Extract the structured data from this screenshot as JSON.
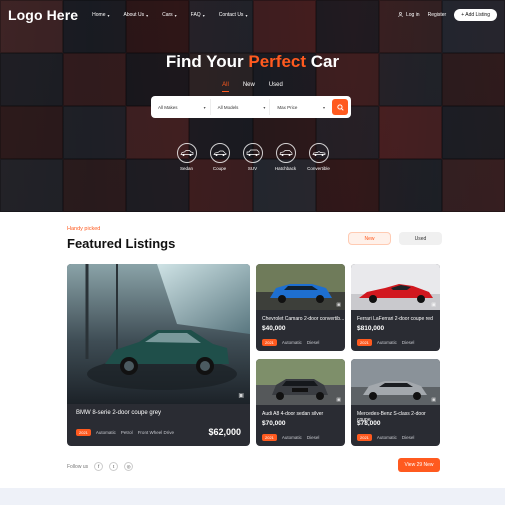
{
  "nav": {
    "logo": "Logo Here",
    "menu": [
      {
        "label": "Home"
      },
      {
        "label": "About Us"
      },
      {
        "label": "Cars"
      },
      {
        "label": "FAQ"
      },
      {
        "label": "Contact Us"
      }
    ],
    "login": "Log in",
    "register": "Register",
    "add_listing": "+ Add Listing"
  },
  "hero": {
    "title_before": "Find Your ",
    "title_accent": "Perfect",
    "title_after": " Car",
    "tabs": [
      "All",
      "New",
      "Used"
    ],
    "active_tab": "All",
    "search": {
      "makes": "All Makes",
      "models": "All Models",
      "price": "Max Price"
    },
    "types": [
      "Sedan",
      "Coupe",
      "SUV",
      "Hatchback",
      "Convertible"
    ]
  },
  "featured": {
    "eyebrow": "Handy picked",
    "title": "Featured Listings",
    "tabs": [
      "New",
      "Used"
    ],
    "active_tab": "New",
    "listings": [
      {
        "name": "BMW 8-serie 2-door coupe grey",
        "price": "$62,000",
        "year": "2021",
        "trans": "Automatic",
        "fuel": "Petrol",
        "drive": "Front Wheel Drive"
      },
      {
        "name": "Chevrolet Camaro 2-door convertib...",
        "price": "$40,000",
        "year": "2021",
        "trans": "Automatic",
        "fuel": "Diesel"
      },
      {
        "name": "Ferrari LaFerrari 2-door coupe red",
        "price": "$810,000",
        "year": "2021",
        "trans": "Automatic",
        "fuel": "Diesel"
      },
      {
        "name": "Audi A8 4-door sedan silver",
        "price": "$70,000",
        "year": "2021",
        "trans": "Automatic",
        "fuel": "Diesel"
      },
      {
        "name": "Mercedes-Benz S-class 2-door coupe",
        "price": "$78,000",
        "year": "2021",
        "trans": "Automatic",
        "fuel": "Diesel"
      }
    ],
    "follow_label": "Follow us",
    "view_button": "View 29 New"
  },
  "colors": {
    "accent": "#ff5a1f",
    "card_bg": "#2a2c33"
  }
}
